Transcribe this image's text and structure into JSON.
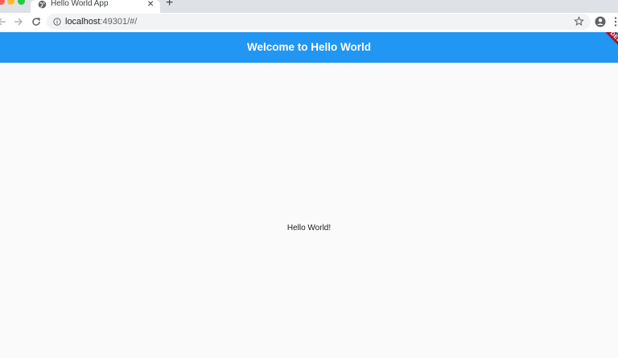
{
  "browser": {
    "tab": {
      "title": "Hello World App",
      "favicon": "globe-icon",
      "close_icon": "close-icon"
    },
    "new_tab_icon": "plus-icon",
    "toolbar": {
      "back_icon": "arrow-left-icon",
      "forward_icon": "arrow-right-icon",
      "reload_icon": "reload-icon",
      "info_icon": "info-icon",
      "url_host": "localhost",
      "url_rest": ":49301/#/",
      "bookmark_icon": "star-icon",
      "profile_icon": "account-circle-icon",
      "menu_icon": "kebab-menu-icon"
    }
  },
  "app": {
    "appbar": {
      "title": "Welcome to Hello World",
      "color": "#2196f3",
      "debug_banner": "DEBUG"
    },
    "body": {
      "text": "Hello World!",
      "background": "#fafafa"
    }
  }
}
